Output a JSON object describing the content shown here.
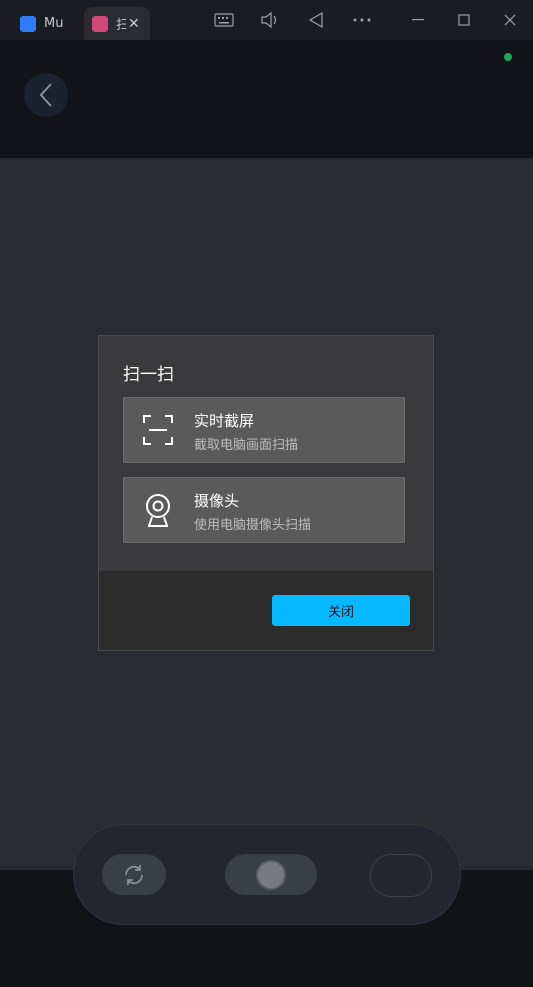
{
  "titlebar": {
    "tabs": [
      {
        "title": "MuMu",
        "icon_color": "#2f7bf5"
      },
      {
        "title": "扫",
        "icon_color": "#d04a78"
      }
    ],
    "icons": [
      "keyboard-icon",
      "volume-icon",
      "back-triangle-icon",
      "more-icon",
      "minimize-icon",
      "maximize-icon",
      "close-icon"
    ]
  },
  "dialog": {
    "title": "扫一扫",
    "options": [
      {
        "title": "实时截屏",
        "desc": "截取电脑画面扫描",
        "icon": "screen-capture-icon"
      },
      {
        "title": "摄像头",
        "desc": "使用电脑摄像头扫描",
        "icon": "webcam-icon"
      }
    ],
    "close_label": "关闭"
  },
  "colors": {
    "accent": "#06b8ff",
    "status": "#1aa85a"
  }
}
